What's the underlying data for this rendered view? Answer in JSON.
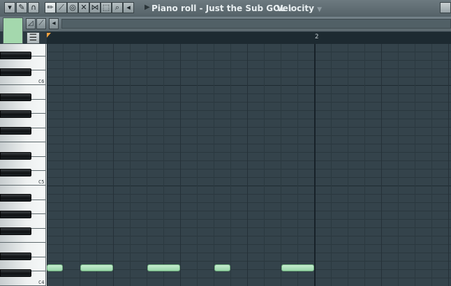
{
  "toolbar": {
    "title": "Piano roll - Just the Sub GOL",
    "target_label": "Velocity",
    "icons": [
      "menu-arrow-icon",
      "wrench-icon",
      "magnet-icon",
      "pencil-icon",
      "brush-icon",
      "delete-icon",
      "mute-icon",
      "slice-icon",
      "select-icon",
      "zoom-icon",
      "playback-icon"
    ]
  },
  "timeline": {
    "bar_label": "2"
  },
  "keyboard": {
    "octave_labels": [
      "C6",
      "C5",
      "C4"
    ]
  },
  "notes": [
    {
      "start_step": 0,
      "length_steps": 1,
      "pitch": "C4"
    },
    {
      "start_step": 2,
      "length_steps": 2,
      "pitch": "C4"
    },
    {
      "start_step": 6,
      "length_steps": 2,
      "pitch": "C4"
    },
    {
      "start_step": 10,
      "length_steps": 1,
      "pitch": "C4"
    },
    {
      "start_step": 14,
      "length_steps": 2,
      "pitch": "C4"
    }
  ],
  "colors": {
    "note": "#9ad7aa",
    "grid_bg": "#34434b",
    "channel_color": "#a4d8ad"
  }
}
